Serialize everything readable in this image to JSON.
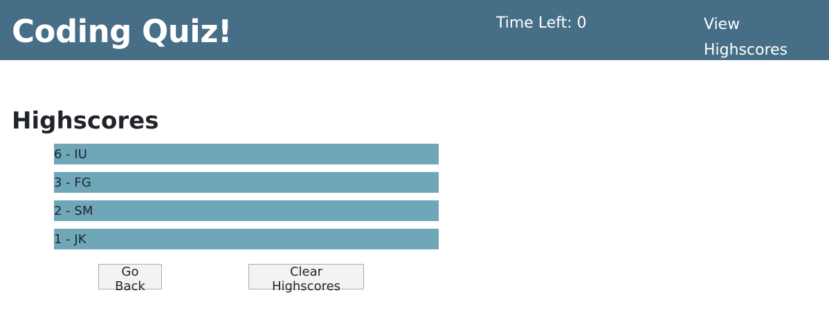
{
  "header": {
    "title": "Coding Quiz!",
    "timer_text": "Time Left: 0",
    "view_highscores_label": "View Highscores",
    "background_color": "#466e87"
  },
  "main": {
    "heading": "Highscores",
    "scores": [
      {
        "text": "6 - IU"
      },
      {
        "text": "3 - FG"
      },
      {
        "text": "2 - SM"
      },
      {
        "text": "1 - JK"
      }
    ],
    "score_row_color": "#6fa7b9",
    "buttons": {
      "go_back_label": "Go Back",
      "clear_label": "Clear Highscores"
    }
  }
}
